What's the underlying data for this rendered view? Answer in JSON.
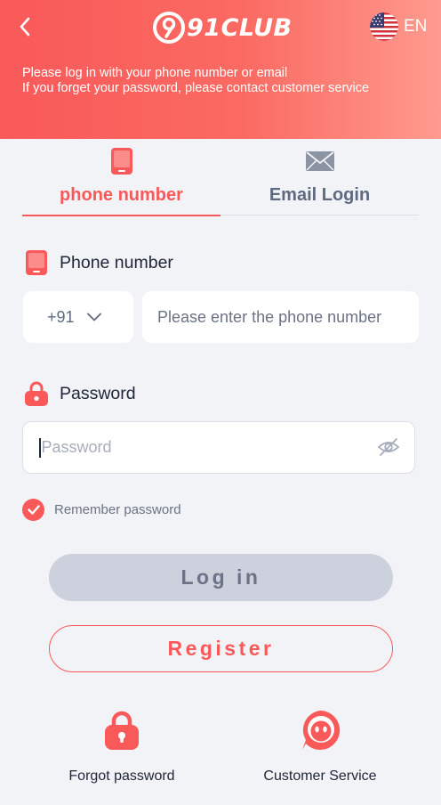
{
  "header": {
    "logo_text": "91CLUB",
    "language": "EN",
    "notice_line1": "Please log in with your phone number or email",
    "notice_line2": "If you forget your password, please contact customer service"
  },
  "tabs": [
    {
      "label": "phone number",
      "icon": "phone-icon",
      "active": true
    },
    {
      "label": "Email Login",
      "icon": "mail-icon",
      "active": false
    }
  ],
  "phone_field": {
    "title": "Phone number",
    "country_code": "+91",
    "placeholder": "Please enter the phone number"
  },
  "password_field": {
    "title": "Password",
    "placeholder": "Password"
  },
  "remember": {
    "label": "Remember password",
    "checked": true
  },
  "buttons": {
    "login": "Log in",
    "register": "Register"
  },
  "bottom_links": {
    "forgot": "Forgot password",
    "service": "Customer Service"
  },
  "colors": {
    "accent": "#f95959",
    "header_gradient_end": "#ff9a8e",
    "background": "#f2f3f7",
    "login_button_disabled": "#cdd0dd"
  }
}
